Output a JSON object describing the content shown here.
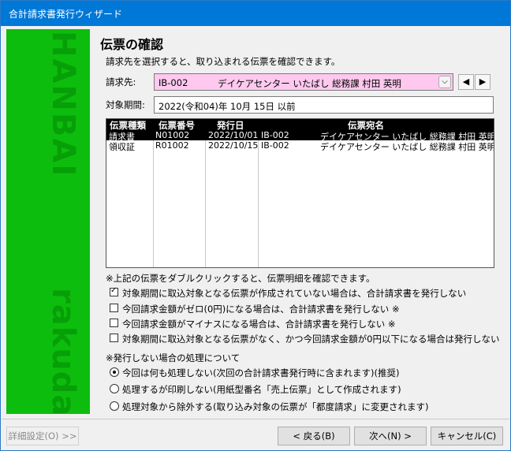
{
  "window": {
    "title": "合計請求書発行ウィザード"
  },
  "banner": {
    "top_text": "HANBAI",
    "bottom_text": "rakuda"
  },
  "heading": "伝票の確認",
  "intro": "請求先を選択すると、取り込まれる伝票を確認できます。",
  "billing_target": {
    "label": "請求先:",
    "code": "IB-002",
    "name": "デイケアセンター  いたばし  総務課  村田  英明",
    "dropdown_icon": "chevron-down-icon"
  },
  "nav": {
    "prev_icon": "triangle-left-icon",
    "next_icon": "triangle-right-icon",
    "prev": "◀",
    "next": "▶"
  },
  "period": {
    "label": "対象期間:",
    "value": "2022(令和04)年  10月  15日  以前"
  },
  "grid": {
    "columns": [
      "伝票種類",
      "伝票番号",
      "発行日",
      "伝票宛名"
    ],
    "rows": [
      {
        "type": "請求書",
        "number": "N01002",
        "date": "2022/10/01",
        "code": "IB-002",
        "recipient": "デイケアセンター  いたばし  総務課  村田  英明",
        "selected": true
      },
      {
        "type": "領収証",
        "number": "R01002",
        "date": "2022/10/15",
        "code": "IB-002",
        "recipient": "デイケアセンター  いたばし  総務課  村田  英明",
        "selected": false
      }
    ]
  },
  "note": "※上記の伝票をダブルクリックすると、伝票明細を確認できます。",
  "checkboxes": [
    {
      "label": "対象期間に取込対象となる伝票が作成されていない場合は、合計請求書を発行しない",
      "checked": true
    },
    {
      "label": "今回請求金額がゼロ(0円)になる場合は、合計請求書を発行しない  ※",
      "checked": false
    },
    {
      "label": "今回請求金額がマイナスになる場合は、合計請求書を発行しない  ※",
      "checked": false
    },
    {
      "label": "対象期間に取込対象となる伝票がなく、かつ今回請求金額が0円以下になる場合は発行しない",
      "checked": false
    }
  ],
  "no_issue_heading": "※発行しない場合の処理について",
  "radios": [
    {
      "label": "今回は何も処理しない(次回の合計請求書発行時に含まれます)(推奨)",
      "selected": true
    },
    {
      "label": "処理するが印刷しない(用紙型番名「売上伝票」として作成されます)",
      "selected": false
    },
    {
      "label": "処理対象から除外する(取り込み対象の伝票が「都度請求」に変更されます)",
      "selected": false
    }
  ],
  "buttons": {
    "detail": "詳細設定(O) >>",
    "back": "< 戻る(B)",
    "next": "次へ(N) >",
    "cancel": "キャンセル(C)"
  }
}
